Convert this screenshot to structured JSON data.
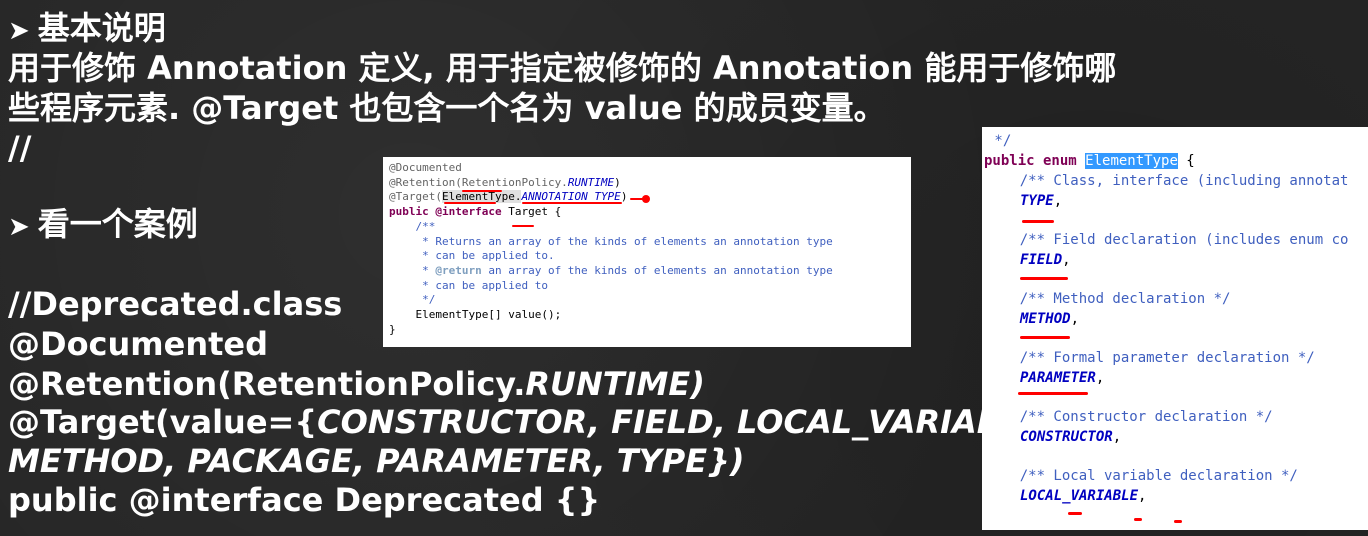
{
  "slide": {
    "heading1": "基本说明",
    "desc_line1": "用于修饰 Annotation 定义, 用于指定被修饰的 Annotation 能用于修饰哪",
    "desc_line2": "些程序元素. @Target 也包含一个名为 value 的成员变量。",
    "comment_slashes": "//",
    "heading2": "看一个案例",
    "code": {
      "line1": "//Deprecated.class",
      "line2": "@Documented",
      "line3_a": "@Retention(RetentionPolicy.",
      "line3_b": "RUNTIME)",
      "line4_a": "@Target(value={",
      "line4_b": "CONSTRUCTOR, FIELD, LOCAL_VARIABLE,",
      "line5": "METHOD, PACKAGE, PARAMETER, TYPE})",
      "line6": "public @interface Deprecated {}"
    }
  },
  "target_source": {
    "l1": "@Documented",
    "l2_a": "@Retention(RetentionPolicy.",
    "l2_b": "RUNTIME",
    "l2_c": ")",
    "l3_a": "@Target(",
    "l3_b": "ElementType.",
    "l3_c": "ANNOTATION_TYPE",
    "l3_d": ")",
    "l4_kw": "public @interface",
    "l4_rest": " Target {",
    "c1": "    /**",
    "c2": "     * Returns an array of the kinds of elements an annotation type",
    "c3": "     * can be applied to.",
    "c4_a": "     * ",
    "c4_tag": "@return",
    "c4_b": " an array of the kinds of elements an annotation type",
    "c5": "     * can be applied to",
    "c6": "     */",
    "m1": "    ElementType[] value();",
    "end": "}"
  },
  "element_type_source": {
    "top": " */",
    "decl_kw": "public enum ",
    "decl_name": "ElementType",
    "decl_end": " {",
    "entries": [
      {
        "comment": "    /** Class, interface (including annotat",
        "name": "TYPE"
      },
      {
        "comment": "    /** Field declaration (includes enum co",
        "name": "FIELD"
      },
      {
        "comment": "    /** Method declaration */",
        "name": "METHOD"
      },
      {
        "comment": "    /** Formal parameter declaration */",
        "name": "PARAMETER"
      },
      {
        "comment": "    /** Constructor declaration */",
        "name": "CONSTRUCTOR"
      },
      {
        "comment": "    /** Local variable declaration */",
        "name": "LOCAL_VARIABLE"
      }
    ],
    "sep": ","
  },
  "colors": {
    "background": "#262626",
    "keyword": "#7f0055",
    "javadoc": "#3f5fbf",
    "enum_constant": "#0000c0",
    "selection": "#3399ff",
    "annotation_mark": "#ff0000"
  }
}
